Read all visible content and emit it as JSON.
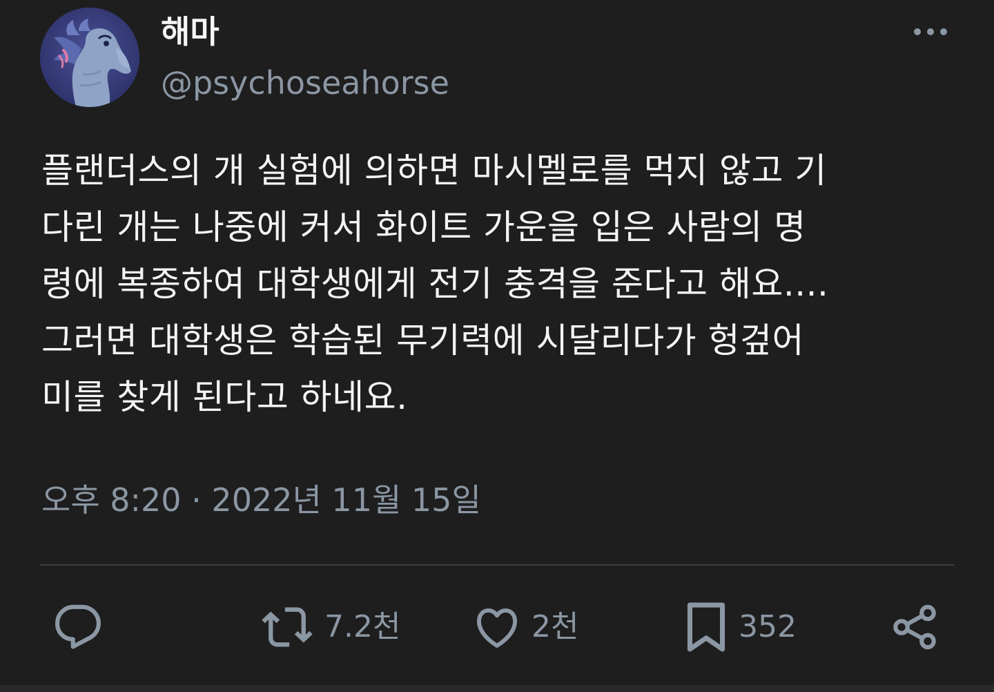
{
  "author": {
    "display_name": "해마",
    "handle": "@psychoseahorse",
    "avatar_icon": "seahorse-avatar"
  },
  "more_icon": "ellipsis-icon",
  "tweet": {
    "lines": [
      "플랜더스의 개 실험에 의하면 마시멜로를 먹지 않고 기",
      "다린 개는 나중에 커서 화이트 가운을 입은 사람의 명",
      "령에 복종하여 대학생에게 전기 충격을 준다고 해요....",
      "그러면 대학생은 학습된 무기력에 시달리다가 헝겊어",
      "미를 찾게 된다고 하네요."
    ]
  },
  "timestamp": "오후 8:20 · 2022년 11월 15일",
  "actions": {
    "reply": {
      "icon": "reply-icon",
      "count": ""
    },
    "retweet": {
      "icon": "retweet-icon",
      "count": "7.2천"
    },
    "like": {
      "icon": "heart-icon",
      "count": "2천"
    },
    "bookmark": {
      "icon": "bookmark-icon",
      "count": "352"
    },
    "share": {
      "icon": "share-icon",
      "count": ""
    }
  },
  "colors": {
    "background": "#1e1e1f",
    "text": "#f4f4f4",
    "secondary": "#8b97a3",
    "divider": "#3c4146",
    "avatar_bg": "#3a3f7a"
  }
}
